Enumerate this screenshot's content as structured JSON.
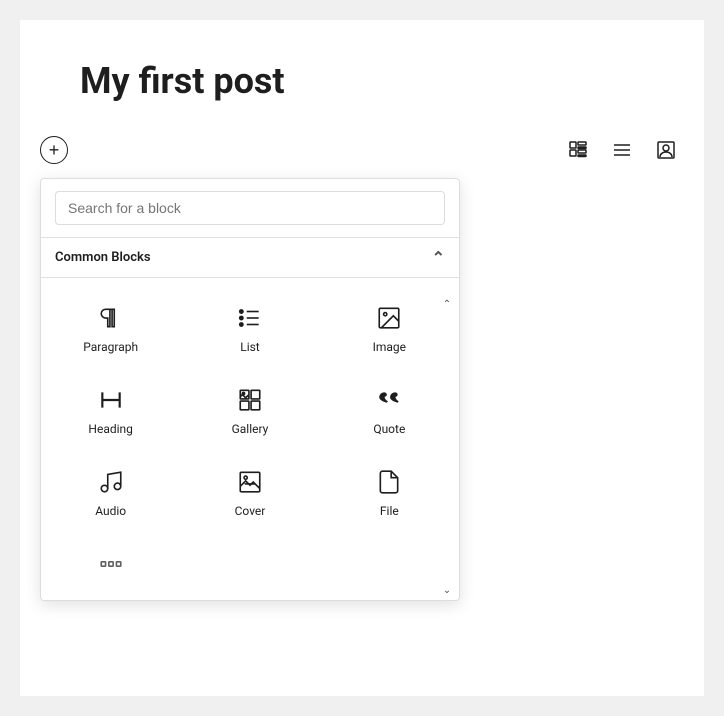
{
  "page": {
    "title": "My first post",
    "background": "#ffffff"
  },
  "toolbar": {
    "add_block_label": "+",
    "icons": [
      {
        "name": "grid-view-icon",
        "label": "Grid view"
      },
      {
        "name": "list-view-icon",
        "label": "List view"
      },
      {
        "name": "user-icon",
        "label": "User"
      }
    ]
  },
  "block_picker": {
    "search_placeholder": "Search for a block",
    "category_label": "Common Blocks",
    "blocks": [
      {
        "id": "paragraph",
        "label": "Paragraph",
        "icon": "paragraph"
      },
      {
        "id": "list",
        "label": "List",
        "icon": "list"
      },
      {
        "id": "image",
        "label": "Image",
        "icon": "image"
      },
      {
        "id": "heading",
        "label": "Heading",
        "icon": "heading"
      },
      {
        "id": "gallery",
        "label": "Gallery",
        "icon": "gallery"
      },
      {
        "id": "quote",
        "label": "Quote",
        "icon": "quote"
      },
      {
        "id": "audio",
        "label": "Audio",
        "icon": "audio"
      },
      {
        "id": "cover",
        "label": "Cover",
        "icon": "cover"
      },
      {
        "id": "file",
        "label": "File",
        "icon": "file"
      },
      {
        "id": "separator",
        "label": "Separator",
        "icon": "separator"
      }
    ]
  }
}
